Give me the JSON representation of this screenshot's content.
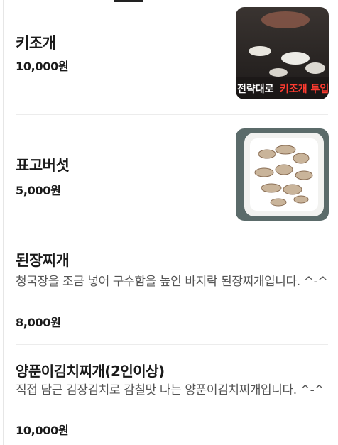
{
  "menu": {
    "items": [
      {
        "name": "키조개",
        "price": "10,000원",
        "image_caption": "키조개 투입",
        "image_caption_prefix": "전략대로"
      },
      {
        "name": "표고버섯",
        "price": "5,000원"
      },
      {
        "name": "된장찌개",
        "description": "청국장을 조금 넣어 구수함을 높인 바지락 된장찌개입니다. ^-^",
        "price": "8,000원"
      },
      {
        "name": "양푼이김치찌개(2인이상)",
        "description": "직접 담근 김장김치로 감칠맛 나는 양푼이김치찌개입니다. ^-^",
        "price": "10,000원"
      }
    ]
  },
  "colors": {
    "caption_red": "#ff3b30",
    "caption_white": "#ffffff"
  }
}
